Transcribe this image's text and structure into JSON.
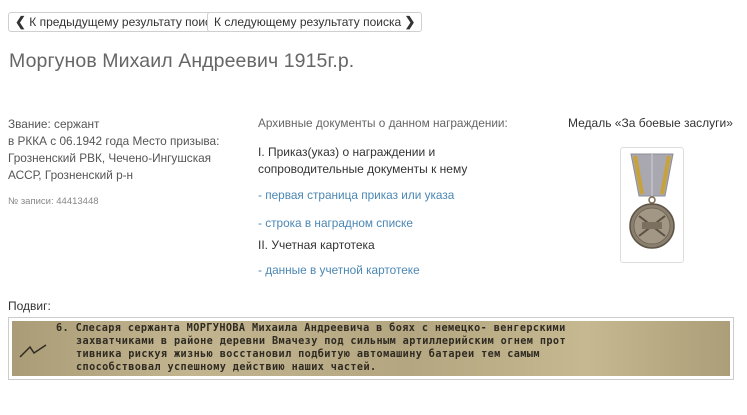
{
  "nav": {
    "prev_label": "К предыдущему результату поиска",
    "next_label": "К следующему результату поиска"
  },
  "person": {
    "name": "Моргунов Михаил Андреевич 1915г.р.",
    "info_lines": [
      "Звание: сержант",
      "в РККА с 06.1942 года Место призыва:",
      "Грозненский РВК, Чечено-Ингушская",
      "АССР, Грозненский р-н"
    ],
    "record": "№ записи: 44413448"
  },
  "archive": {
    "heading": "Архивные документы о данном награждении:",
    "section1": "I. Приказ(указ) о награждении и сопроводительные документы к нему",
    "link1": "- первая страница приказ или указа",
    "link2": "- строка в наградном списке",
    "section2": "II. Учетная картотека",
    "link3": "- данные в учетной картотеке"
  },
  "award": {
    "name": "Медаль «За боевые заслуги»"
  },
  "feat": {
    "label": "Подвиг:",
    "lines": [
      "6. Слесаря сержанта МОРГУНОВА Михаила Андреевича в боях с немецко- венгерскими",
      "захватчиками в районе деревни Вмачезу под сильным артиллерийским огнем прот",
      "тивника рискуя жизнью восстановил подбитую автомашину батареи тем самым",
      "способствовал успешному действию наших частей."
    ]
  },
  "icons": {
    "prev": "chevron-left-icon",
    "next": "chevron-right-icon",
    "medal": "medal-icon"
  },
  "colors": {
    "link": "#4b87b4",
    "document_paper": "#b8ab86"
  }
}
